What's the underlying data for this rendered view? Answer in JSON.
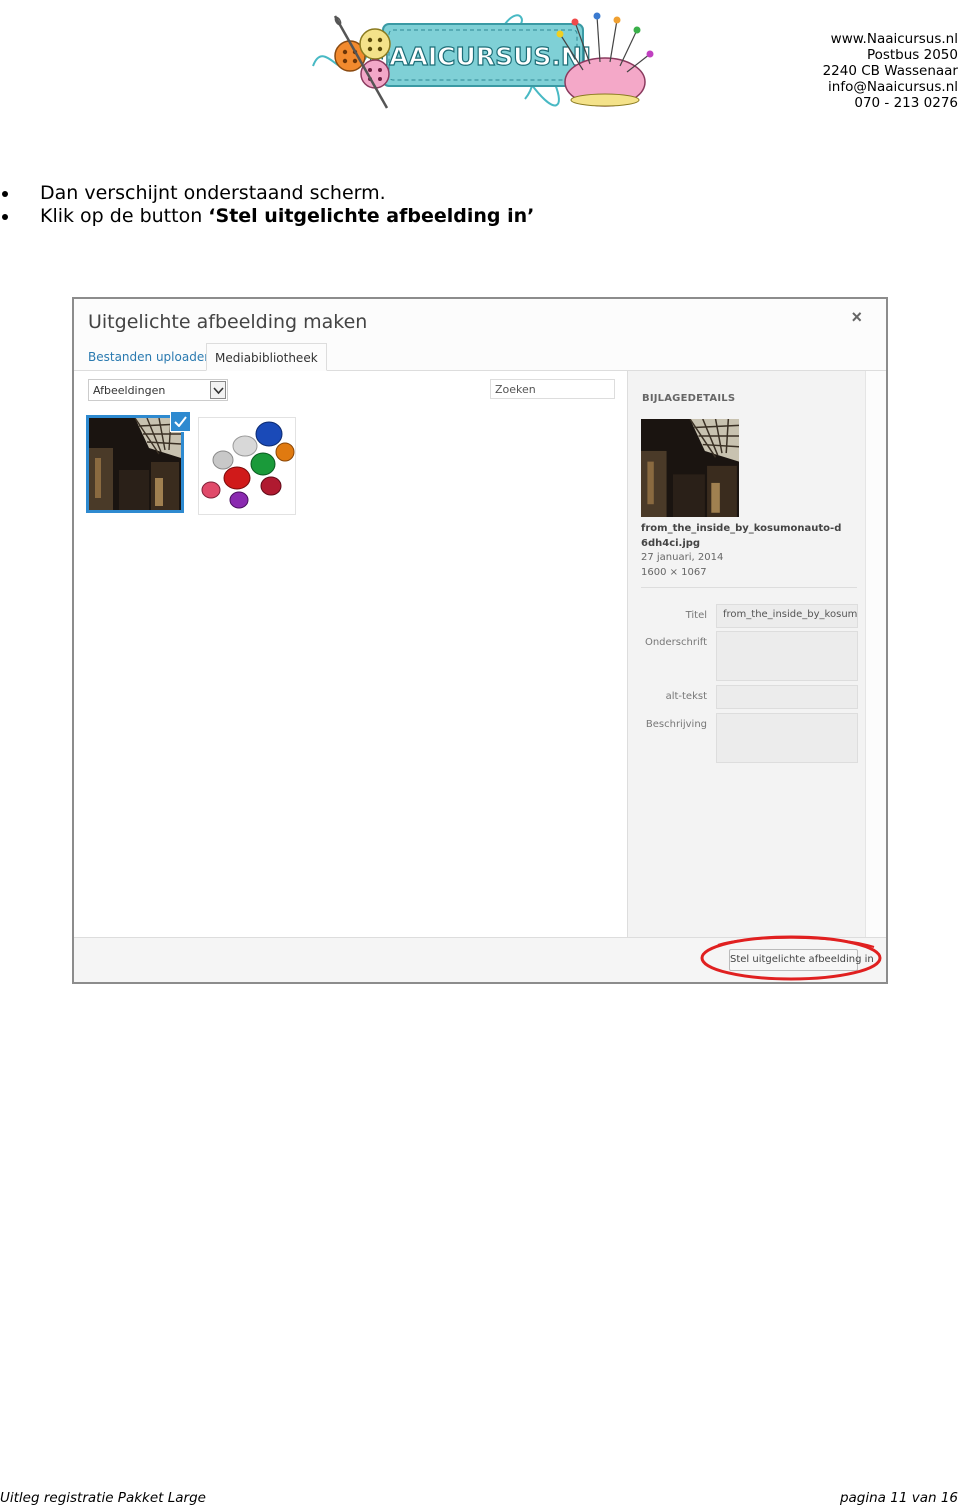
{
  "header": {
    "logo_text": "NAAICURSUS.NL",
    "contact": [
      "www.Naaicursus.nl",
      "Postbus 2050",
      "2240 CB  Wassenaar",
      "info@Naaicursus.nl",
      "070 - 213 0276"
    ]
  },
  "instructions": [
    {
      "text": "Dan verschijnt onderstaand scherm.",
      "bold": ""
    },
    {
      "text": "Klik op de button ",
      "bold": "‘Stel uitgelichte afbeelding in’"
    }
  ],
  "dialog": {
    "title": "Uitgelichte afbeelding maken",
    "close_glyph": "×",
    "tabs": [
      "Bestanden uploaden",
      "Mediabibliotheek"
    ],
    "filter_value": "Afbeeldingen",
    "search_placeholder": "Zoeken",
    "details": {
      "heading": "BIJLAGEDETAILS",
      "filename": "from_the_inside_by_kosumonauto-d6dh4ci.jpg",
      "date": "27 januari, 2014",
      "dimensions": "1600 × 1067"
    },
    "fields": {
      "title_label": "Titel",
      "title_value": "from_the_inside_by_kosumon",
      "caption_label": "Onderschrift",
      "alt_label": "alt-tekst",
      "description_label": "Beschrijving"
    },
    "set_button": "Stel uitgelichte afbeelding in"
  },
  "footer": {
    "left": "Uitleg registratie Pakket Large",
    "right": "pagina 11 van 16"
  },
  "colors": {
    "accent_blue": "#2e8ad0",
    "highlight_red": "#e02020",
    "logo_teal": "#5fc4c8"
  }
}
